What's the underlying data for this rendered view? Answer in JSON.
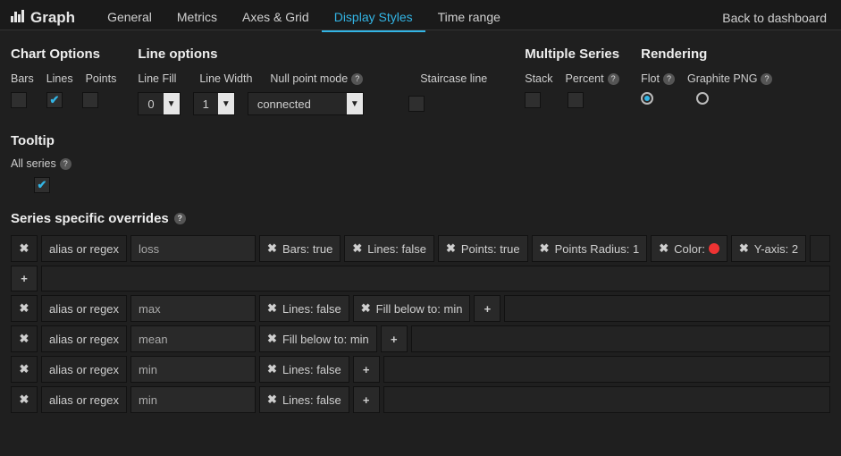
{
  "header": {
    "title": "Graph",
    "tabs": [
      "General",
      "Metrics",
      "Axes & Grid",
      "Display Styles",
      "Time range"
    ],
    "active_tab": "Display Styles",
    "back_link": "Back to dashboard"
  },
  "chart_options": {
    "heading": "Chart Options",
    "labels": {
      "bars": "Bars",
      "lines": "Lines",
      "points": "Points"
    },
    "values": {
      "bars": false,
      "lines": true,
      "points": false
    }
  },
  "line_options": {
    "heading": "Line options",
    "labels": {
      "fill": "Line Fill",
      "width": "Line Width",
      "null_mode": "Null point mode",
      "staircase": "Staircase line"
    },
    "values": {
      "fill": "0",
      "width": "1",
      "null_mode": "connected",
      "staircase": false
    }
  },
  "multiple_series": {
    "heading": "Multiple Series",
    "labels": {
      "stack": "Stack",
      "percent": "Percent"
    },
    "values": {
      "stack": false,
      "percent": false
    }
  },
  "rendering": {
    "heading": "Rendering",
    "labels": {
      "flot": "Flot",
      "graphite": "Graphite PNG"
    },
    "selected": "flot"
  },
  "tooltip": {
    "heading": "Tooltip",
    "label": "All series",
    "value": true
  },
  "overrides_heading": "Series specific overrides",
  "alias_label": "alias or regex",
  "overrides": [
    {
      "alias": "loss",
      "tags": [
        "Bars: true",
        "Lines: false",
        "Points: true",
        "Points Radius: 1",
        "Color:",
        "Y-axis: 2"
      ],
      "color": "#e33",
      "has_add_row": true
    },
    {
      "alias": "max",
      "tags": [
        "Lines: false",
        "Fill below to: min"
      ]
    },
    {
      "alias": "mean",
      "tags": [
        "Fill below to: min"
      ]
    },
    {
      "alias": "min",
      "tags": [
        "Lines: false"
      ]
    },
    {
      "alias": "min",
      "tags": [
        "Lines: false"
      ]
    }
  ]
}
